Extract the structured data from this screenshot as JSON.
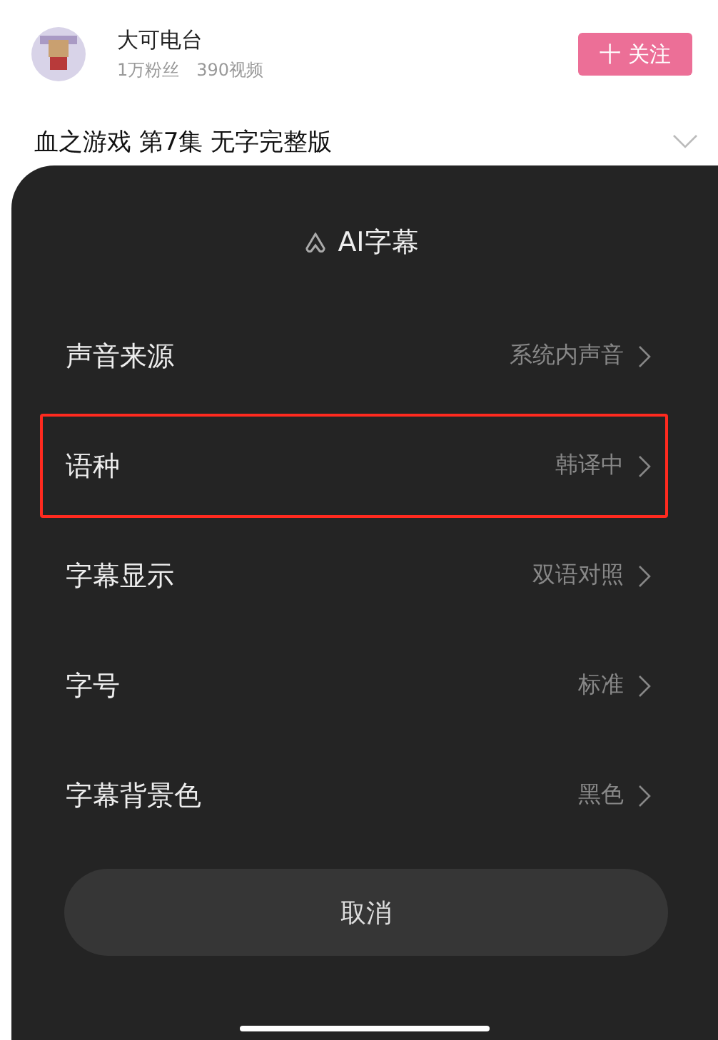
{
  "channel": {
    "name": "大可电台",
    "followers": "1万粉丝",
    "videos": "390视频",
    "follow_button": "十 关注"
  },
  "video_title": "血之游戏 第7集 无字完整版",
  "sheet": {
    "title": "AI字幕",
    "rows": [
      {
        "label": "声音来源",
        "value": "系统内声音",
        "highlighted": false
      },
      {
        "label": "语种",
        "value": "韩译中",
        "highlighted": true
      },
      {
        "label": "字幕显示",
        "value": "双语对照",
        "highlighted": false
      },
      {
        "label": "字号",
        "value": "标准",
        "highlighted": false
      },
      {
        "label": "字幕背景色",
        "value": "黑色",
        "highlighted": false
      }
    ],
    "cancel": "取消"
  }
}
